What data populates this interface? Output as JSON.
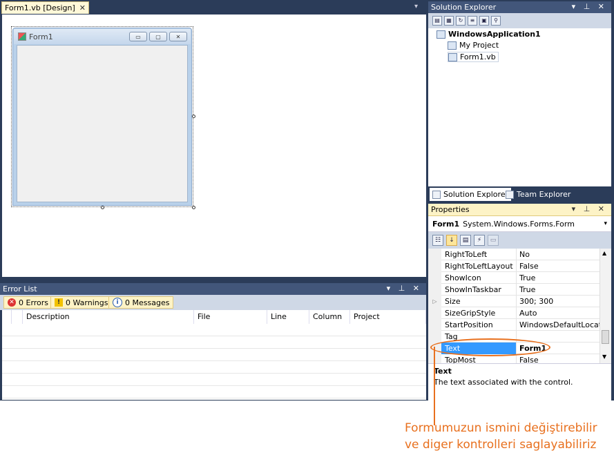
{
  "designer": {
    "tab_label": "Form1.vb [Design]",
    "tab_close": "✕",
    "dropdown": "▾",
    "form_title": "Form1",
    "caption_buttons": [
      "▭",
      "▢",
      "✕"
    ]
  },
  "error_list": {
    "title": "Error List",
    "controls": "▾ ⊥ ✕",
    "errors_label": "0 Errors",
    "warnings_label": "0 Warnings",
    "messages_label": "0 Messages",
    "columns": [
      "Description",
      "File",
      "Line",
      "Column",
      "Project"
    ]
  },
  "solution_explorer": {
    "title": "Solution Explorer",
    "controls": "▾ ⊥ ✕",
    "tree": {
      "root": "WindowsApplication1",
      "items": [
        "My Project",
        "Form1.vb"
      ]
    },
    "tabs": [
      "Solution Explorer",
      "Team Explorer"
    ]
  },
  "properties": {
    "title": "Properties",
    "controls": "▾ ⊥ ✕",
    "object_name": "Form1",
    "object_type": "System.Windows.Forms.Form",
    "rows": [
      {
        "name": "RightToLeft",
        "value": "No"
      },
      {
        "name": "RightToLeftLayout",
        "value": "False"
      },
      {
        "name": "ShowIcon",
        "value": "True"
      },
      {
        "name": "ShowInTaskbar",
        "value": "True"
      },
      {
        "name": "Size",
        "value": "300; 300"
      },
      {
        "name": "SizeGripStyle",
        "value": "Auto"
      },
      {
        "name": "StartPosition",
        "value": "WindowsDefaultLocation"
      },
      {
        "name": "Tag",
        "value": ""
      },
      {
        "name": "Text",
        "value": "Form1"
      },
      {
        "name": "TopMost",
        "value": "False"
      }
    ],
    "selected_row": "Text",
    "description_title": "Text",
    "description_text": "The text associated with the control."
  },
  "annotation": {
    "line1": "Formumuzun ismini değiştirebilir",
    "line2": "ve diger kontrolleri saglayabiliriz",
    "color": "#e8701e"
  },
  "colors": {
    "ide_background": "#2b3c59",
    "panel_header": "#42567a",
    "active_header": "#fdf3c6",
    "selection": "#3399ff"
  }
}
